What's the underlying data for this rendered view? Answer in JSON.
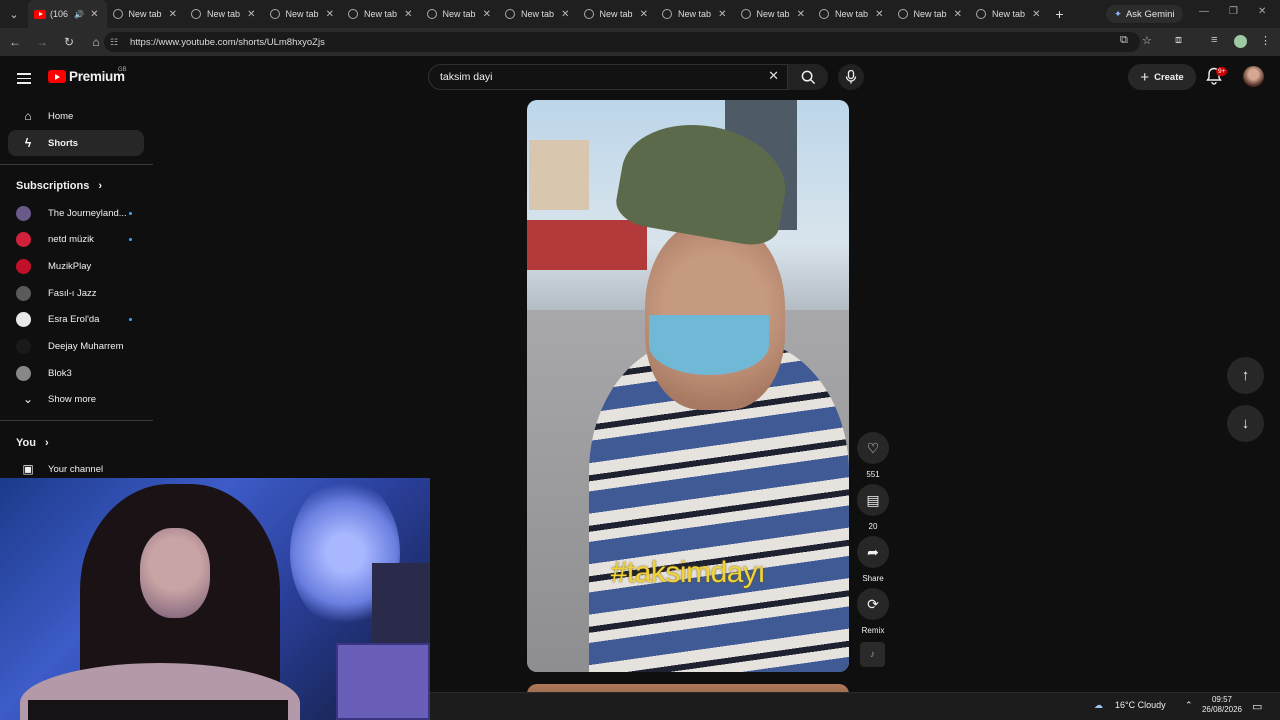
{
  "browser": {
    "tabs": [
      {
        "title": "(106",
        "active": true,
        "audio": true
      },
      {
        "title": "New tab"
      },
      {
        "title": "New tab"
      },
      {
        "title": "New tab"
      },
      {
        "title": "New tab"
      },
      {
        "title": "New tab"
      },
      {
        "title": "New tab"
      },
      {
        "title": "New tab"
      },
      {
        "title": "New tab"
      },
      {
        "title": "New tab"
      },
      {
        "title": "New tab"
      },
      {
        "title": "New tab"
      },
      {
        "title": "New tab"
      }
    ],
    "ask_gemini": "Ask Gemini",
    "url": "https://www.youtube.com/shorts/ULm8hxyoZjs"
  },
  "youtube": {
    "logo_text": "Premium",
    "region": "GB",
    "search_query": "taksim dayi",
    "create_label": "Create",
    "notif_badge": "9+",
    "sidebar": {
      "home": "Home",
      "shorts": "Shorts",
      "subscriptions_header": "Subscriptions",
      "subscriptions": [
        {
          "name": "The Journeyland...",
          "new": true,
          "color": "#6a5a8a"
        },
        {
          "name": "netd müzik",
          "new": true,
          "color": "#d0203a"
        },
        {
          "name": "MuzikPlay",
          "new": false,
          "color": "#c0102a"
        },
        {
          "name": "Fasıl-ı Jazz",
          "new": false,
          "color": "#5a5a5a"
        },
        {
          "name": "Esra Erol'da",
          "new": true,
          "color": "#e8e8e8"
        },
        {
          "name": "Deejay Muharrem",
          "new": false,
          "color": "#1a1a1a"
        },
        {
          "name": "Blok3",
          "new": false,
          "color": "#888888"
        }
      ],
      "show_more": "Show more",
      "you_header": "You",
      "your_channel": "Your channel"
    },
    "short": {
      "overlay_text": "#taksimdayı",
      "likes": "551",
      "comments": "20",
      "share": "Share",
      "remix": "Remix"
    }
  },
  "taskbar": {
    "weather": "16°C  Cloudy",
    "time": "09:57",
    "date": "26/08/2026"
  }
}
